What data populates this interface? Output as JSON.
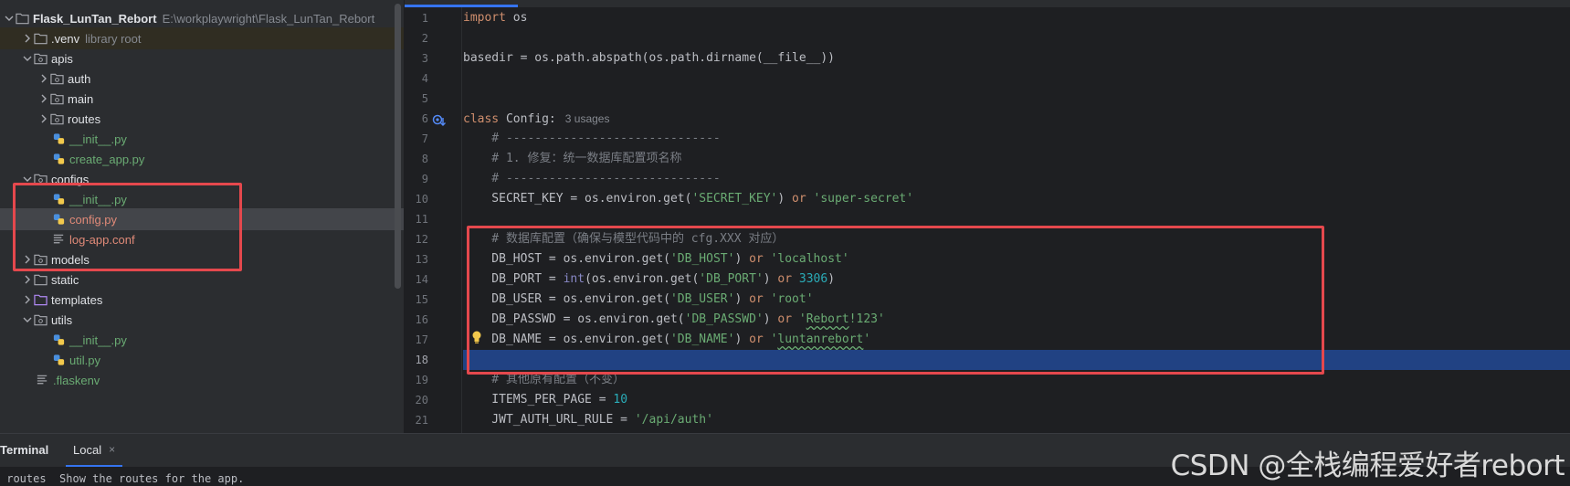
{
  "project": {
    "name": "Flask_LunTan_Rebort",
    "path": "E:\\workplaywright\\Flask_LunTan_Rebort",
    "items": [
      {
        "label": ".venv",
        "hint": "library root"
      },
      {
        "label": "apis"
      },
      {
        "label": "auth"
      },
      {
        "label": "main"
      },
      {
        "label": "routes"
      },
      {
        "label": "__init__.py"
      },
      {
        "label": "create_app.py"
      },
      {
        "label": "configs"
      },
      {
        "label": "__init__.py"
      },
      {
        "label": "config.py"
      },
      {
        "label": "log-app.conf"
      },
      {
        "label": "models"
      },
      {
        "label": "static"
      },
      {
        "label": "templates"
      },
      {
        "label": "utils"
      },
      {
        "label": "__init__.py"
      },
      {
        "label": "util.py"
      },
      {
        "label": ".flaskenv"
      }
    ]
  },
  "editor": {
    "line_numbers": [
      "1",
      "2",
      "3",
      "4",
      "5",
      "6",
      "7",
      "8",
      "9",
      "10",
      "11",
      "12",
      "13",
      "14",
      "15",
      "16",
      "17",
      "18",
      "19",
      "20",
      "21"
    ],
    "code": {
      "l1_kw": "import",
      "l1_rest": " os",
      "l3": "basedir = os.path.abspath(os.path.dirname(__file__))",
      "l6_kw": "class",
      "l6_rest": " Config:",
      "l6_usages": "3 usages",
      "l7": "    # ------------------------------",
      "l8": "    # 1. 修复：统一数据库配置项名称",
      "l9": "    # ------------------------------",
      "l10_a": "    SECRET_KEY = os.environ.get(",
      "l10_s1": "'SECRET_KEY'",
      "l10_b": ") ",
      "l10_or": "or",
      "l10_c": " ",
      "l10_s2": "'super-secret'",
      "l12": "    # 数据库配置（确保与模型代码中的 cfg.XXX 对应）",
      "l13_a": "    DB_HOST = os.environ.get(",
      "l13_s1": "'DB_HOST'",
      "l13_b": ") ",
      "l13_or": "or",
      "l13_c": " ",
      "l13_s2": "'localhost'",
      "l14_a": "    DB_PORT = ",
      "l14_int": "int",
      "l14_b": "(os.environ.get(",
      "l14_s1": "'DB_PORT'",
      "l14_c": ") ",
      "l14_or": "or",
      "l14_d": " ",
      "l14_num": "3306",
      "l14_e": ")",
      "l15_a": "    DB_USER = os.environ.get(",
      "l15_s1": "'DB_USER'",
      "l15_b": ") ",
      "l15_or": "or",
      "l15_c": " ",
      "l15_s2": "'root'",
      "l16_a": "    DB_PASSWD = os.environ.get(",
      "l16_s1": "'DB_PASSWD'",
      "l16_b": ") ",
      "l16_or": "or",
      "l16_c": " ",
      "l16_q1": "'",
      "l16_s2": "Rebort",
      "l16_s3": "!123'",
      "l17_a": "    DB_NAME = os.environ.get(",
      "l17_s1": "'DB_NAME'",
      "l17_b": ") ",
      "l17_or": "or",
      "l17_c": " ",
      "l17_q1": "'",
      "l17_s2": "luntanrebort",
      "l17_q2": "'",
      "l19": "    # 其他原有配置（不变）",
      "l20_a": "    ITEMS_PER_PAGE = ",
      "l20_num": "10",
      "l21_a": "    JWT_AUTH_URL_RULE = ",
      "l21_s": "'/api/auth'"
    }
  },
  "terminal": {
    "title": "Terminal",
    "tab_label": "Local",
    "close_glyph": "×",
    "output": " routes  Show the routes for the app."
  },
  "watermark": "CSDN @全栈编程爱好者rebort",
  "colors": {
    "accent": "#3574f0",
    "highlight_box": "#e5484d",
    "current_line": "#214283",
    "string": "#6aab73",
    "keyword": "#cf8e6d",
    "number": "#2aacb8"
  }
}
